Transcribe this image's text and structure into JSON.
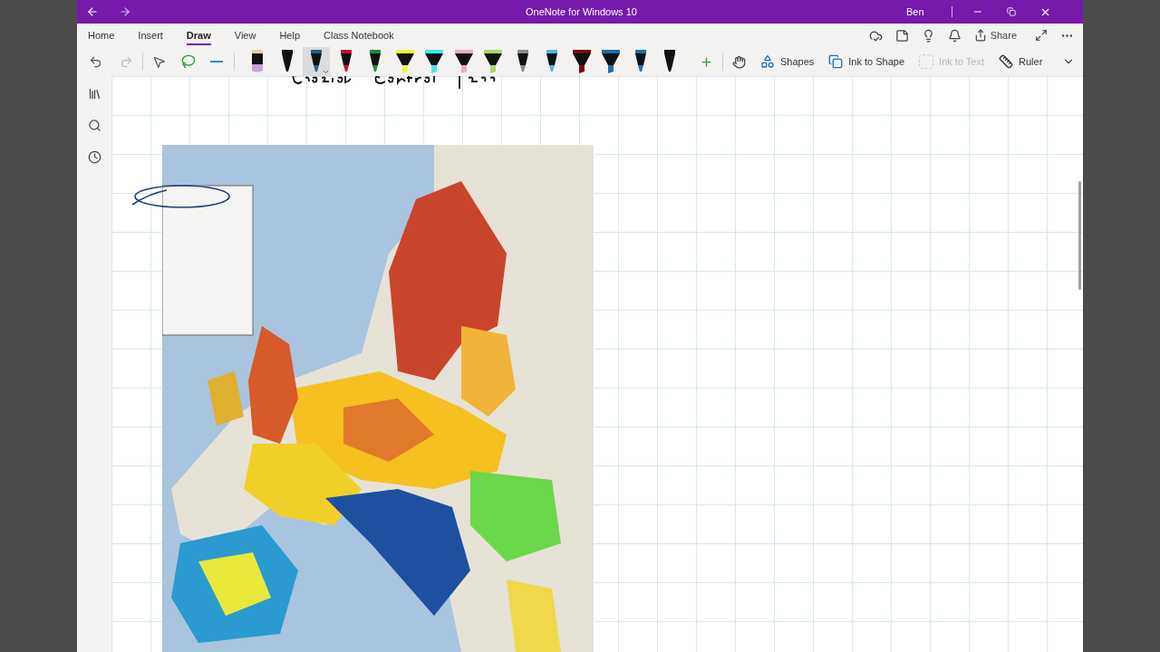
{
  "window": {
    "title": "OneNote for Windows 10",
    "user": "Ben"
  },
  "tabs": [
    {
      "label": "Home",
      "selected": false
    },
    {
      "label": "Insert",
      "selected": false
    },
    {
      "label": "Draw",
      "selected": true
    },
    {
      "label": "View",
      "selected": false
    },
    {
      "label": "Help",
      "selected": false
    },
    {
      "label": "Class Notebook",
      "selected": false
    }
  ],
  "share": "Share",
  "pens": [
    {
      "kind": "pencil",
      "color": "#c9a0d8",
      "selected": false
    },
    {
      "kind": "pen",
      "color": "#111111",
      "selected": false
    },
    {
      "kind": "pen",
      "color": "#1f5f8b",
      "selected": true
    },
    {
      "kind": "pen",
      "color": "#c8102e",
      "selected": false
    },
    {
      "kind": "pen",
      "color": "#1e8a3c",
      "selected": false
    },
    {
      "kind": "highlighter",
      "color": "#f5f235",
      "selected": false
    },
    {
      "kind": "highlighter",
      "color": "#3ee8ee",
      "selected": false
    },
    {
      "kind": "highlighter",
      "color": "#f2a6c8",
      "selected": false
    },
    {
      "kind": "highlighter",
      "color": "#a8d86a",
      "selected": false
    },
    {
      "kind": "pen",
      "color": "#8a8a8a",
      "selected": false
    },
    {
      "kind": "pen",
      "color": "#4ab8e0",
      "selected": false
    },
    {
      "kind": "highlighter",
      "color": "#7a0d0d",
      "selected": false
    },
    {
      "kind": "highlighter",
      "color": "#1e6fa8",
      "selected": false
    },
    {
      "kind": "pen",
      "color": "#1e6fa8",
      "selected": false
    },
    {
      "kind": "pen",
      "color": "#111111",
      "selected": false
    }
  ],
  "tools": [
    {
      "kind": "shapes",
      "label": "Shapes",
      "disabled": false
    },
    {
      "kind": "ink-to-shape",
      "label": "Ink to Shape",
      "disabled": false
    },
    {
      "kind": "ink-to-text",
      "label": "Ink to Text",
      "disabled": true
    },
    {
      "kind": "ruler",
      "label": "Ruler",
      "disabled": false
    }
  ]
}
